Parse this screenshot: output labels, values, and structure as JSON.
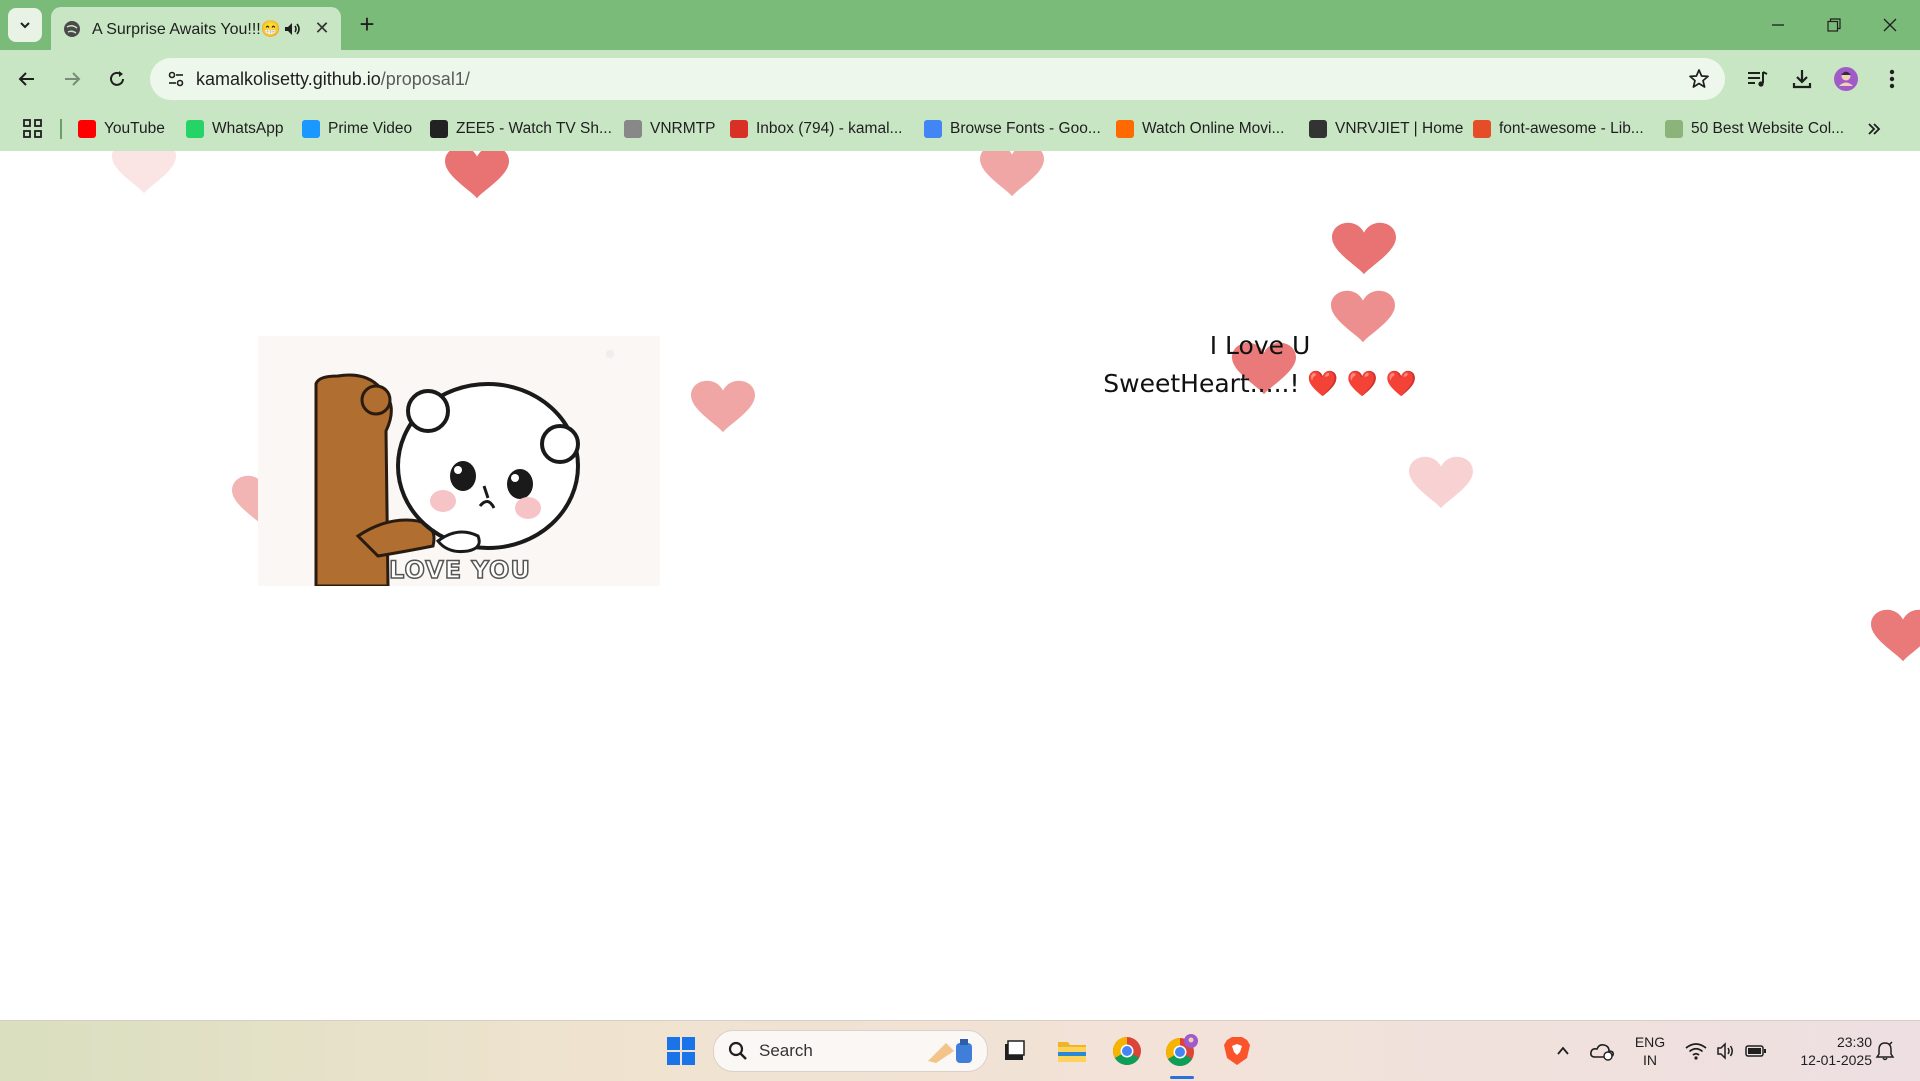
{
  "browser": {
    "tab_title": "A Surprise Awaits You!!!😁",
    "new_tab_symbol": "+",
    "close_tab_symbol": "✕",
    "url_host": "kamalkolisetty.github.io",
    "url_path": "/proposal1/"
  },
  "bookmarks": [
    {
      "label": "YouTube",
      "icon": "youtube-icon",
      "color": "#ff0000"
    },
    {
      "label": "WhatsApp",
      "icon": "whatsapp-icon",
      "color": "#25d366"
    },
    {
      "label": "Prime Video",
      "icon": "prime-video-icon",
      "color": "#1a98ff"
    },
    {
      "label": "ZEE5 - Watch TV Sh...",
      "icon": "zee5-icon",
      "color": "#222222"
    },
    {
      "label": "VNRMTP",
      "icon": "vnrmtp-icon",
      "color": "#888888"
    },
    {
      "label": "Inbox (794) - kamal...",
      "icon": "gmail-icon",
      "color": "#d93025"
    },
    {
      "label": "Browse Fonts - Goo...",
      "icon": "google-fonts-icon",
      "color": "#4285f4"
    },
    {
      "label": "Watch Online Movi...",
      "icon": "aha-icon",
      "color": "#ff6a00"
    },
    {
      "label": "VNRVJIET | Home",
      "icon": "globe-icon",
      "color": "#333333"
    },
    {
      "label": "font-awesome - Lib...",
      "icon": "code-icon",
      "color": "#e44d26"
    },
    {
      "label": "50 Best Website Col...",
      "icon": "d-icon",
      "color": "#8bb37a"
    }
  ],
  "page": {
    "message_line1": "I Love U",
    "message_line2": "SweetHeart.....! ❤️ ❤️ ❤️",
    "gif_caption": "LOVE YOU",
    "heart_color": "#e86a6a"
  },
  "taskbar": {
    "search_placeholder": "Search",
    "lang_line1": "ENG",
    "lang_line2": "IN",
    "time": "23:30",
    "date": "12-01-2025"
  }
}
